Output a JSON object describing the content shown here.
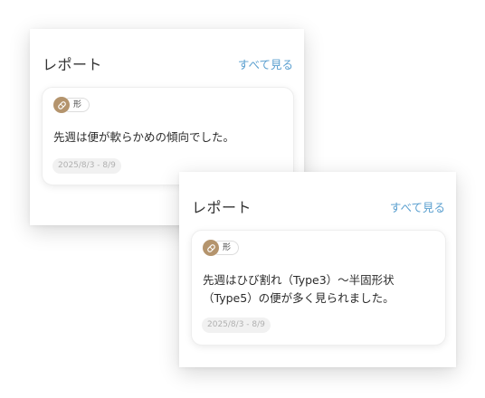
{
  "reports": [
    {
      "title": "レポート",
      "see_all_label": "すべて見る",
      "card": {
        "tag_icon": "pill-icon",
        "tag_label": "形",
        "text_lines": [
          "先週は便が軟らかめの傾向でした。"
        ],
        "date_range": "2025/8/3 - 8/9"
      }
    },
    {
      "title": "レポート",
      "see_all_label": "すべて見る",
      "card": {
        "tag_icon": "pill-icon",
        "tag_label": "形",
        "text_lines": [
          "先週はひび割れ（Type3）〜半固形状",
          "（Type5）の便が多く見られました。"
        ],
        "date_range": "2025/8/3 - 8/9"
      }
    }
  ],
  "colors": {
    "accent_link": "#5a9fcf",
    "tag_icon_bg": "#b4946d",
    "date_badge_bg": "#f1f1f1"
  }
}
